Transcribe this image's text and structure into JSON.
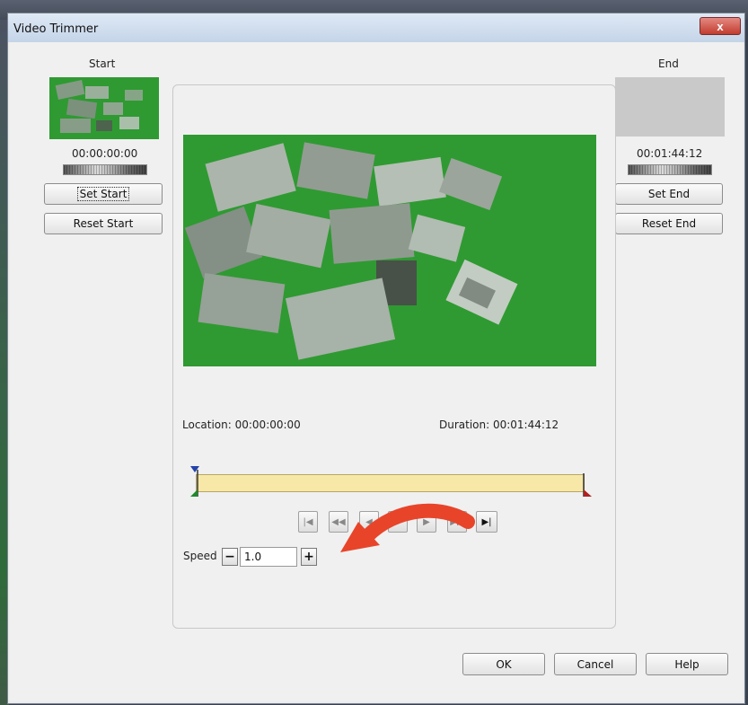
{
  "window": {
    "title": "Video Trimmer",
    "close_label": "x"
  },
  "start": {
    "heading": "Start",
    "timecode": "00:00:00:00",
    "set_label": "Set Start",
    "reset_label": "Reset Start"
  },
  "end": {
    "heading": "End",
    "timecode": "00:01:44:12",
    "set_label": "Set End",
    "reset_label": "Reset End"
  },
  "player": {
    "location_text": "Location: 00:00:00:00",
    "duration_text": "Duration: 00:01:44:12",
    "transport_icons": [
      "go-to-start-icon",
      "rewind-icon",
      "step-back-icon",
      "play-icon",
      "step-forward-icon",
      "fast-forward-icon",
      "go-to-end-icon"
    ]
  },
  "speed": {
    "label": "Speed",
    "value": "1.0",
    "minus": "−",
    "plus": "+"
  },
  "footer": {
    "ok": "OK",
    "cancel": "Cancel",
    "help": "Help"
  },
  "colors": {
    "video_bg": "#2f9a32",
    "track_fill": "#f7e8a8",
    "annotation_arrow": "#e8442a"
  }
}
